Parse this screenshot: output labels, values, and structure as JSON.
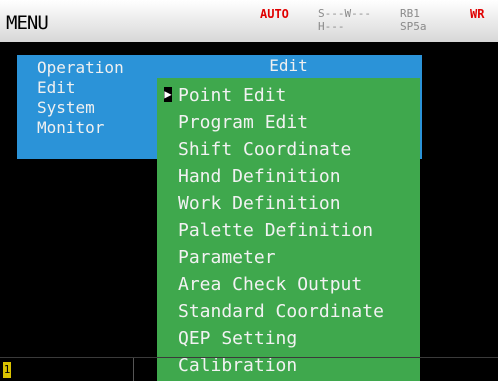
{
  "header": {
    "title": "MENU",
    "status": {
      "auto": "AUTO",
      "line1": "S---W---",
      "line2": "H---",
      "right1": "RB1",
      "right2": "SP5a",
      "wr": "WR"
    }
  },
  "menu": {
    "categories": [
      {
        "label": "Operation"
      },
      {
        "label": "Edit"
      },
      {
        "label": "System"
      },
      {
        "label": "Monitor"
      }
    ],
    "selected_category_header": "Edit",
    "submenu": [
      {
        "label": "Point Edit"
      },
      {
        "label": "Program Edit"
      },
      {
        "label": "Shift Coordinate"
      },
      {
        "label": "Hand Definition"
      },
      {
        "label": "Work Definition"
      },
      {
        "label": "Palette Definition"
      },
      {
        "label": "Parameter"
      },
      {
        "label": "Area Check Output"
      },
      {
        "label": "Standard Coordinate"
      },
      {
        "label": "QEP Setting"
      },
      {
        "label": "Calibration"
      }
    ],
    "cursor_glyph": "▶"
  },
  "footer": {
    "indicator": "1"
  },
  "colors": {
    "header_bg": "#ffffff",
    "panel_blue": "#2b93d8",
    "panel_green": "#3fa84d",
    "status_red": "#e00000",
    "background": "#000000"
  }
}
